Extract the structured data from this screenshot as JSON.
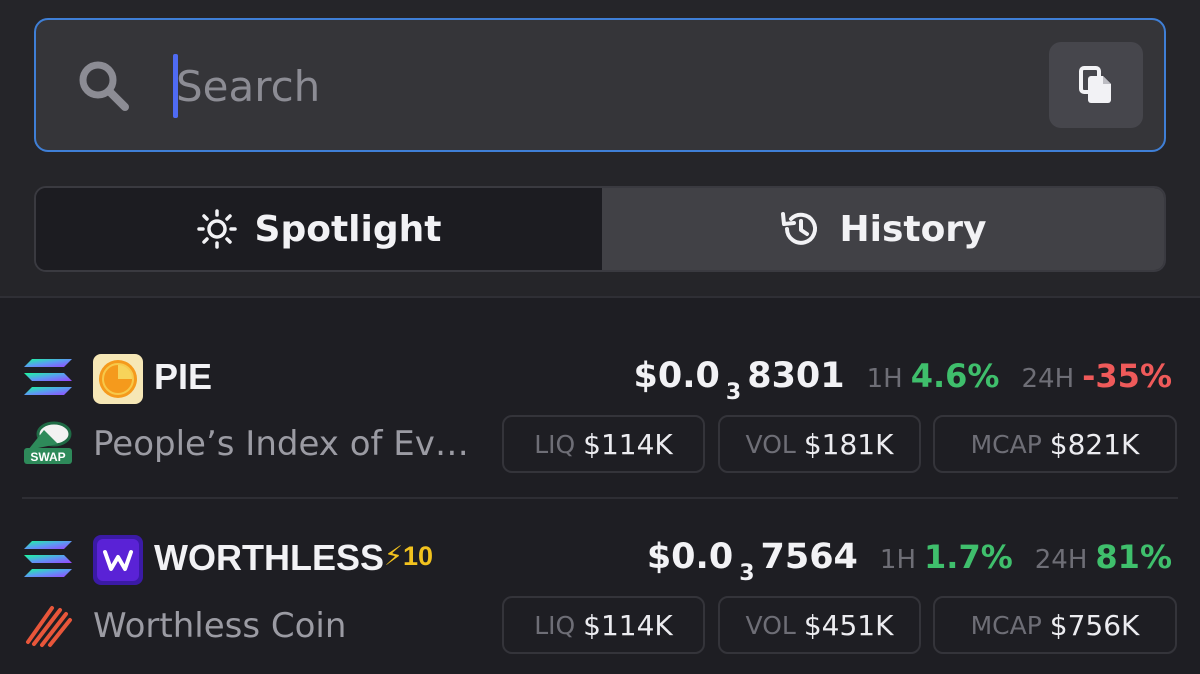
{
  "search": {
    "placeholder": "Search",
    "value": ""
  },
  "tabs": [
    {
      "label": "Spotlight",
      "icon": "sun-icon",
      "selected": true
    },
    {
      "label": "History",
      "icon": "history-icon",
      "selected": false
    }
  ],
  "tokens": [
    {
      "symbol": "PIE",
      "name": "People’s Index of Ev…",
      "price_main": "$0.0",
      "price_zeros": "3",
      "price_digits": "8301",
      "change_1h_label": "1H",
      "change_1h": "4.6%",
      "change_24h_label": "24H",
      "change_24h": "-35%",
      "stats": [
        {
          "label": "LIQ",
          "value": "$114K"
        },
        {
          "label": "VOL",
          "value": "$181K"
        },
        {
          "label": "MCAP",
          "value": "$821K"
        }
      ],
      "chain_icon": "solana-icon",
      "dex_icon": "swap-dex-icon",
      "logo_icon": "pie-logo-icon"
    },
    {
      "symbol": "WORTHLESS",
      "name": "Worthless Coin",
      "boost": "⚡10",
      "price_main": "$0.0",
      "price_zeros": "3",
      "price_digits": "7564",
      "change_1h_label": "1H",
      "change_1h": "1.7%",
      "change_24h_label": "24H",
      "change_24h": "81%",
      "stats": [
        {
          "label": "LIQ",
          "value": "$114K"
        },
        {
          "label": "VOL",
          "value": "$451K"
        },
        {
          "label": "MCAP",
          "value": "$756K"
        }
      ],
      "chain_icon": "solana-icon",
      "dex_icon": "pump-dex-icon",
      "logo_icon": "worthless-logo-icon"
    }
  ],
  "colors": {
    "accent_border": "#3f7fd6",
    "caret": "#4f6bf3",
    "positive": "#3fbf6c",
    "negative": "#ef5a5a",
    "boost": "#f2c21e"
  }
}
